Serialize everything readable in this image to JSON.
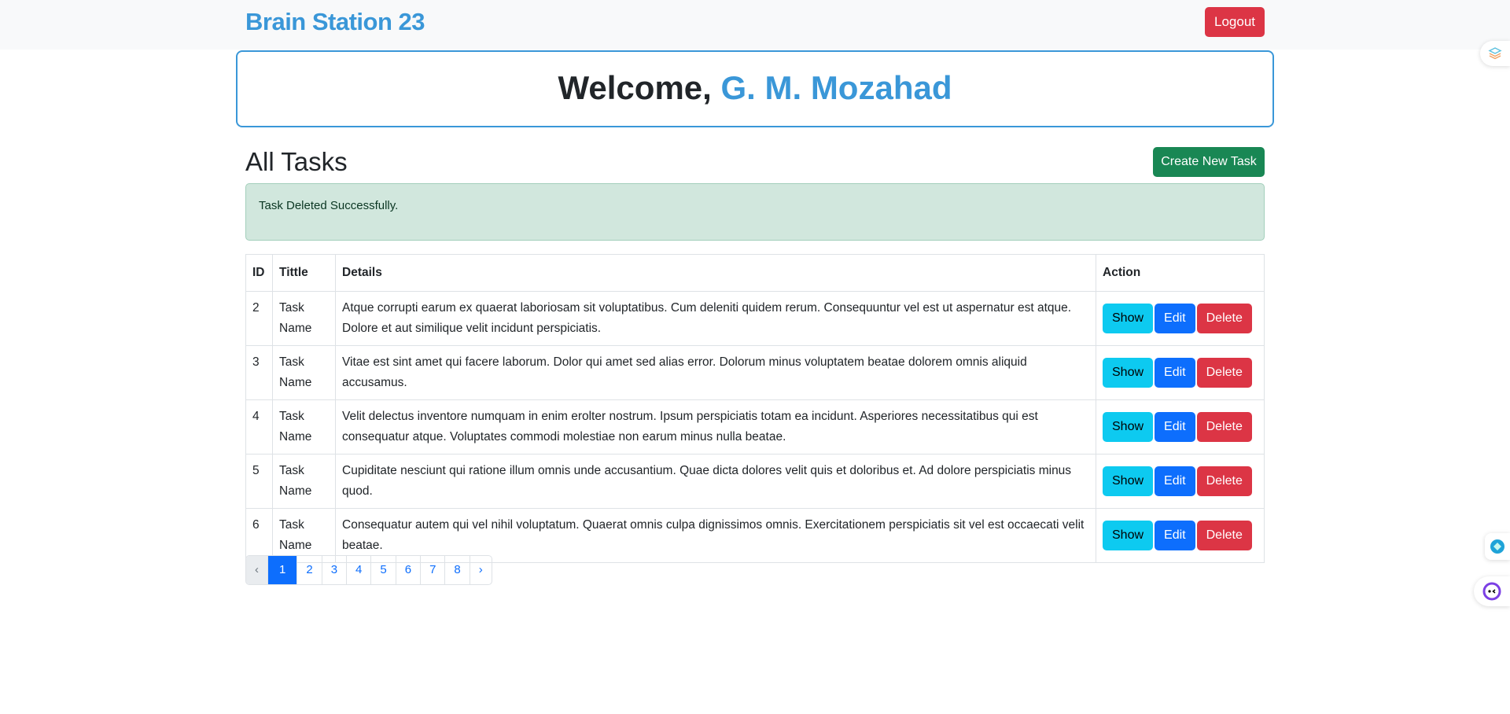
{
  "nav": {
    "brand": "Brain Station 23",
    "logout": "Logout"
  },
  "welcome": {
    "prefix": "Welcome, ",
    "name": "G. M. Mozahad"
  },
  "main": {
    "title": "All Tasks",
    "create": "Create New Task",
    "alert": "Task Deleted Successfully."
  },
  "table": {
    "headers": [
      "ID",
      "Tittle",
      "Details",
      "Action"
    ],
    "rows": [
      {
        "id": "2",
        "title": "Task Name",
        "details": "Atque corrupti earum ex quaerat laboriosam sit voluptatibus. Cum deleniti quidem rerum. Consequuntur vel est ut aspernatur est atque. Dolore et aut similique velit incidunt perspiciatis."
      },
      {
        "id": "3",
        "title": "Task Name",
        "details": "Vitae est sint amet qui facere laborum. Dolor qui amet sed alias error. Dolorum minus voluptatem beatae dolorem omnis aliquid accusamus."
      },
      {
        "id": "4",
        "title": "Task Name",
        "details": "Velit delectus inventore numquam in enim erolter nostrum. Ipsum perspiciatis totam ea incidunt. Asperiores necessitatibus qui est consequatur atque. Voluptates commodi molestiae non earum minus nulla beatae."
      },
      {
        "id": "5",
        "title": "Task Name",
        "details": "Cupiditate nesciunt qui ratione illum omnis unde accusantium. Quae dicta dolores velit quis et doloribus et. Ad dolore perspiciatis minus quod."
      },
      {
        "id": "6",
        "title": "Task Name",
        "details": "Consequatur autem qui vel nihil voluptatum. Quaerat omnis culpa dignissimos omnis. Exercitationem perspiciatis sit vel est occaecati velit beatae."
      }
    ],
    "actions": {
      "show": "Show",
      "edit": "Edit",
      "delete": "Delete"
    }
  },
  "pagination": {
    "prev": "‹",
    "pages": [
      "1",
      "2",
      "3",
      "4",
      "5",
      "6",
      "7",
      "8"
    ],
    "next": "›",
    "current": "1"
  }
}
